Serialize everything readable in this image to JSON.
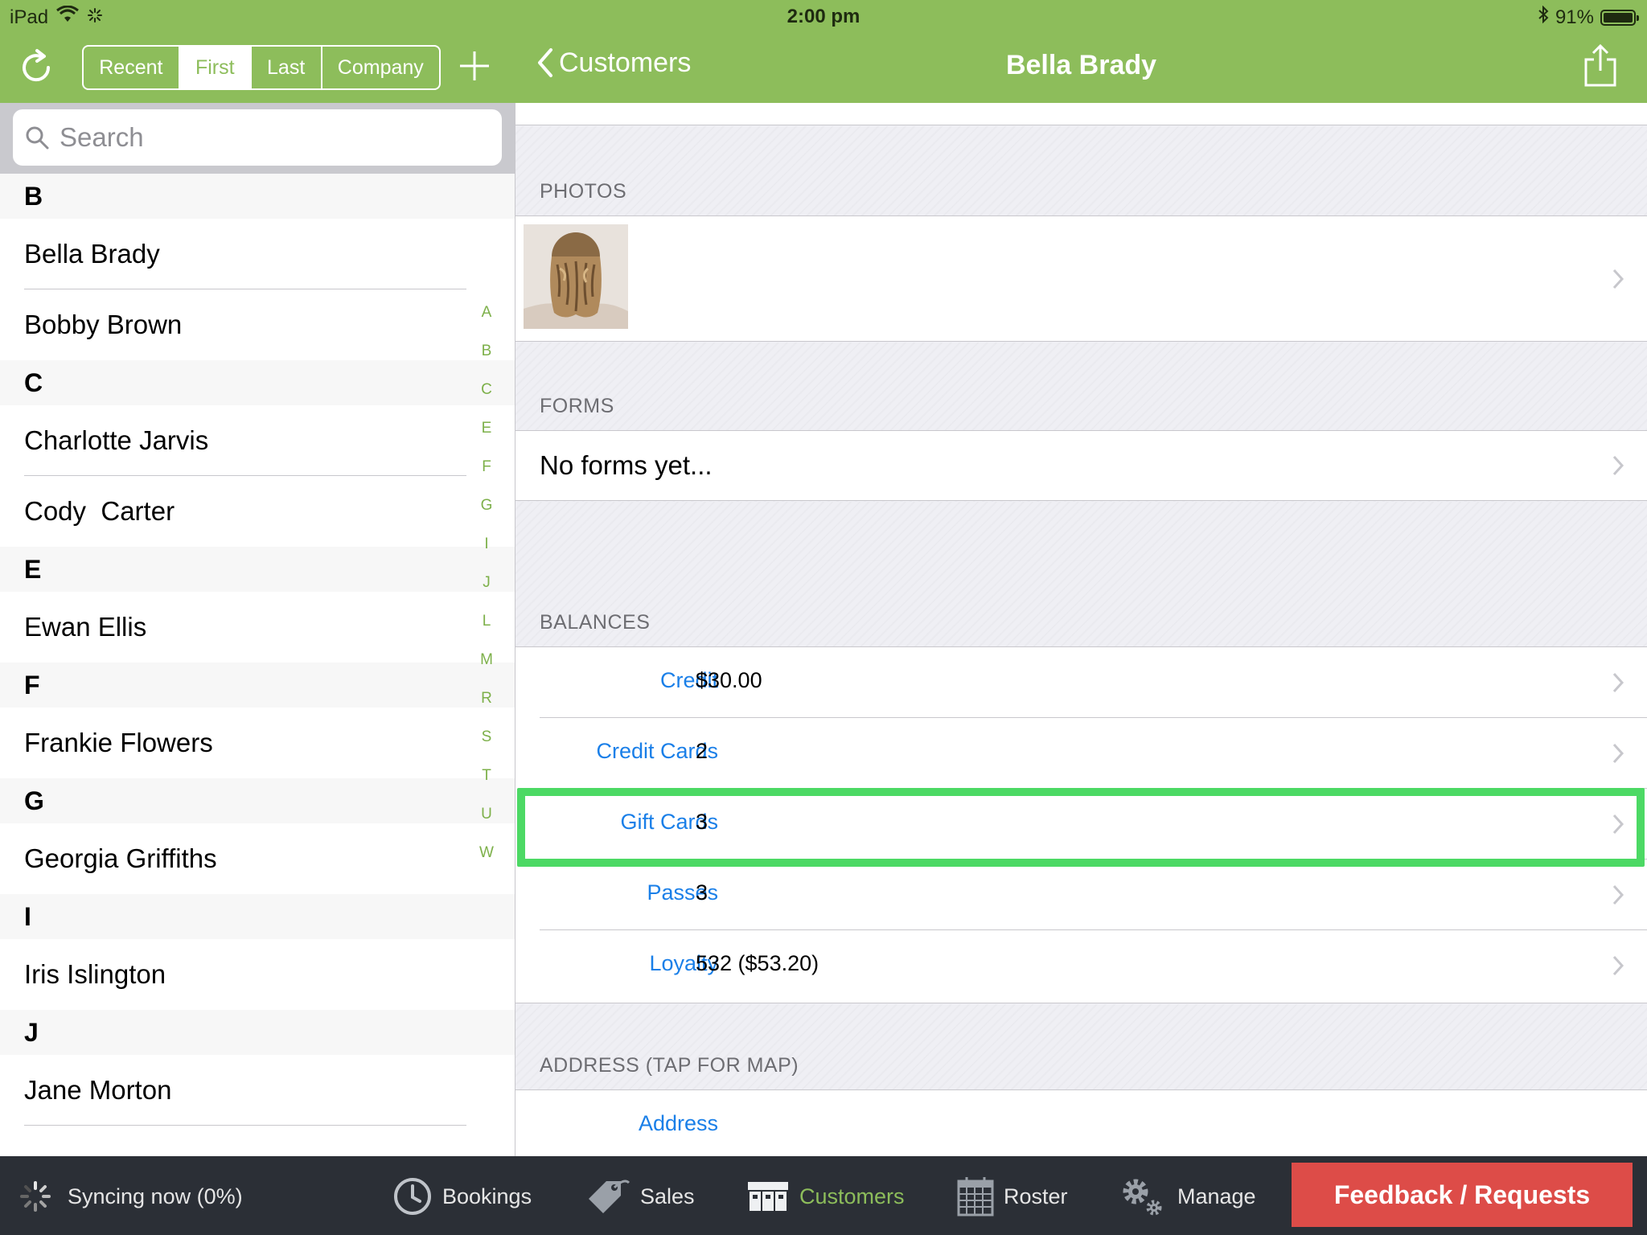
{
  "status_bar": {
    "device": "iPad",
    "time": "2:00 pm",
    "battery": "91%"
  },
  "master_nav": {
    "segments": [
      "Recent",
      "First",
      "Last",
      "Company"
    ],
    "active_segment": "First"
  },
  "search": {
    "placeholder": "Search"
  },
  "customer_sections": [
    {
      "letter": "B",
      "names": [
        "Bella Brady",
        "Bobby Brown"
      ]
    },
    {
      "letter": "C",
      "names": [
        "Charlotte Jarvis",
        "Cody  Carter"
      ]
    },
    {
      "letter": "E",
      "names": [
        "Ewan Ellis"
      ]
    },
    {
      "letter": "F",
      "names": [
        "Frankie Flowers"
      ]
    },
    {
      "letter": "G",
      "names": [
        "Georgia Griffiths"
      ]
    },
    {
      "letter": "I",
      "names": [
        "Iris Islington"
      ]
    },
    {
      "letter": "J",
      "names": [
        "Jane Morton"
      ]
    }
  ],
  "section_index": [
    "A",
    "B",
    "C",
    "E",
    "F",
    "G",
    "I",
    "J",
    "L",
    "M",
    "R",
    "S",
    "T",
    "U",
    "W"
  ],
  "detail_nav": {
    "back_label": "Customers",
    "title": "Bella Brady"
  },
  "photos": {
    "label": "PHOTOS"
  },
  "forms": {
    "label": "FORMS",
    "empty_text": "No forms yet..."
  },
  "balances": {
    "label": "BALANCES",
    "rows": [
      {
        "key": "Credit",
        "value": "$30.00"
      },
      {
        "key": "Credit Cards",
        "value": "2"
      },
      {
        "key": "Gift Cards",
        "value": "3"
      },
      {
        "key": "Passes",
        "value": "3"
      },
      {
        "key": "Loyalty",
        "value": "532 ($53.20)"
      }
    ],
    "highlighted_row": "Gift Cards"
  },
  "address": {
    "label": "ADDRESS (TAP FOR MAP)",
    "field_label": "Address"
  },
  "tab_bar": {
    "sync_status": "Syncing now (0%)",
    "tabs": [
      {
        "label": "Bookings",
        "icon": "clock-icon"
      },
      {
        "label": "Sales",
        "icon": "tag-icon"
      },
      {
        "label": "Customers",
        "icon": "register-icon",
        "active": true
      },
      {
        "label": "Roster",
        "icon": "calendar-icon"
      },
      {
        "label": "Manage",
        "icon": "gears-icon"
      }
    ],
    "feedback_label": "Feedback / Requests"
  },
  "colors": {
    "accent_green": "#8dbd5b",
    "link_blue": "#1a7fe8",
    "highlight_green": "#4cd964",
    "feedback_red": "#dd4c48",
    "tab_bar_bg": "#2b2f36"
  }
}
